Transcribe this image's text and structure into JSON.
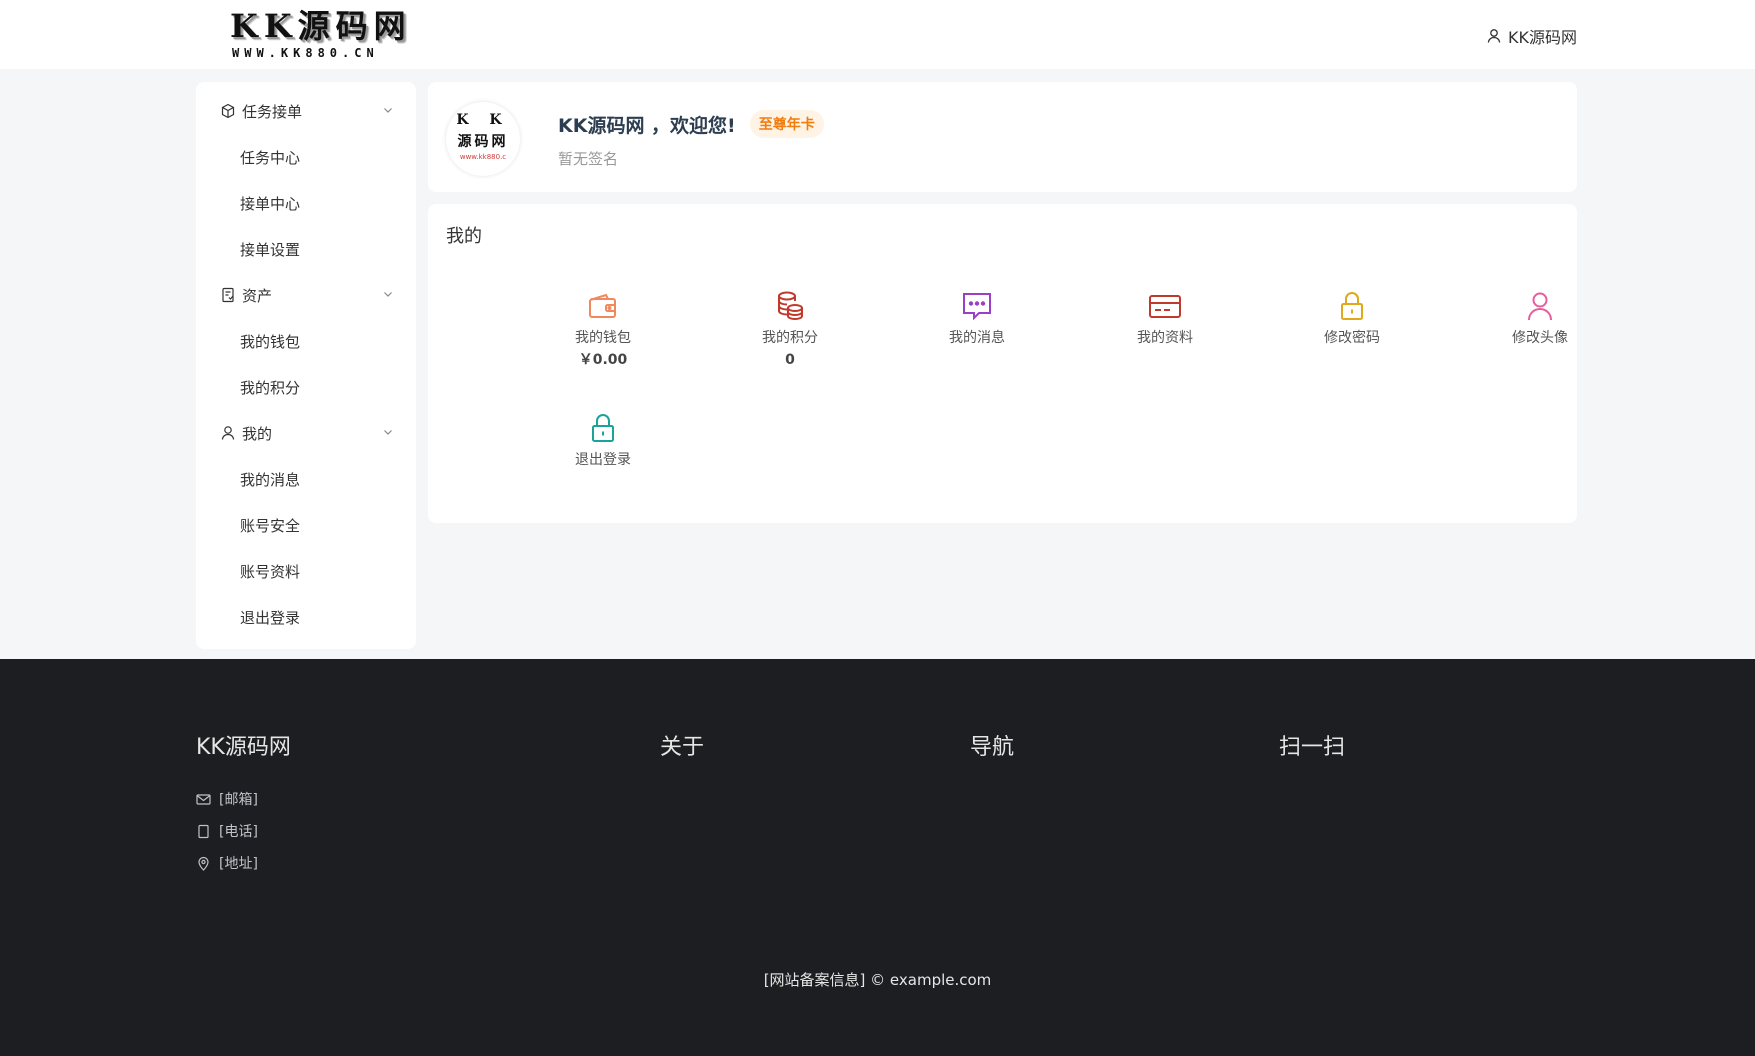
{
  "header": {
    "logo_main": "KK源码网",
    "logo_sub": "WWW.KK880.CN",
    "user_name": "KK源码网"
  },
  "sidebar": {
    "groups": [
      {
        "label": "任务接单",
        "icon": "cube-icon",
        "items": [
          "任务中心",
          "接单中心",
          "接单设置"
        ]
      },
      {
        "label": "资产",
        "icon": "ledger-icon",
        "items": [
          "我的钱包",
          "我的积分"
        ]
      },
      {
        "label": "我的",
        "icon": "user-icon",
        "items": [
          "我的消息",
          "账号安全",
          "账号资料",
          "退出登录"
        ]
      }
    ]
  },
  "profile": {
    "avatar_line1": "K K",
    "avatar_line2": "源码网",
    "avatar_line3": "www.kk880.c",
    "welcome": "KK源码网 ，欢迎您!",
    "badge": "至尊年卡",
    "signature": "暂无签名"
  },
  "mine": {
    "title": "我的",
    "items": [
      {
        "label": "我的钱包",
        "value": "￥0.00",
        "icon": "wallet-icon",
        "color": "#f08a5d"
      },
      {
        "label": "我的积分",
        "value": "0",
        "icon": "coins-icon",
        "color": "#c0392b"
      },
      {
        "label": "我的消息",
        "value": "",
        "icon": "message-icon",
        "color": "#9b3fc4"
      },
      {
        "label": "我的资料",
        "value": "",
        "icon": "card-icon",
        "color": "#c0392b"
      },
      {
        "label": "修改密码",
        "value": "",
        "icon": "lock-icon",
        "color": "#e0a81c"
      },
      {
        "label": "修改头像",
        "value": "",
        "icon": "user-icon",
        "color": "#e85d9b"
      },
      {
        "label": "退出登录",
        "value": "",
        "icon": "lock-icon",
        "color": "#1aa39a"
      }
    ]
  },
  "footer": {
    "site_name": "KK源码网",
    "about_title": "关于",
    "nav_title": "导航",
    "scan_title": "扫一扫",
    "email": "[邮箱]",
    "phone": "[电话]",
    "address": "[地址]",
    "copyright": "[网站备案信息] © example.com"
  }
}
